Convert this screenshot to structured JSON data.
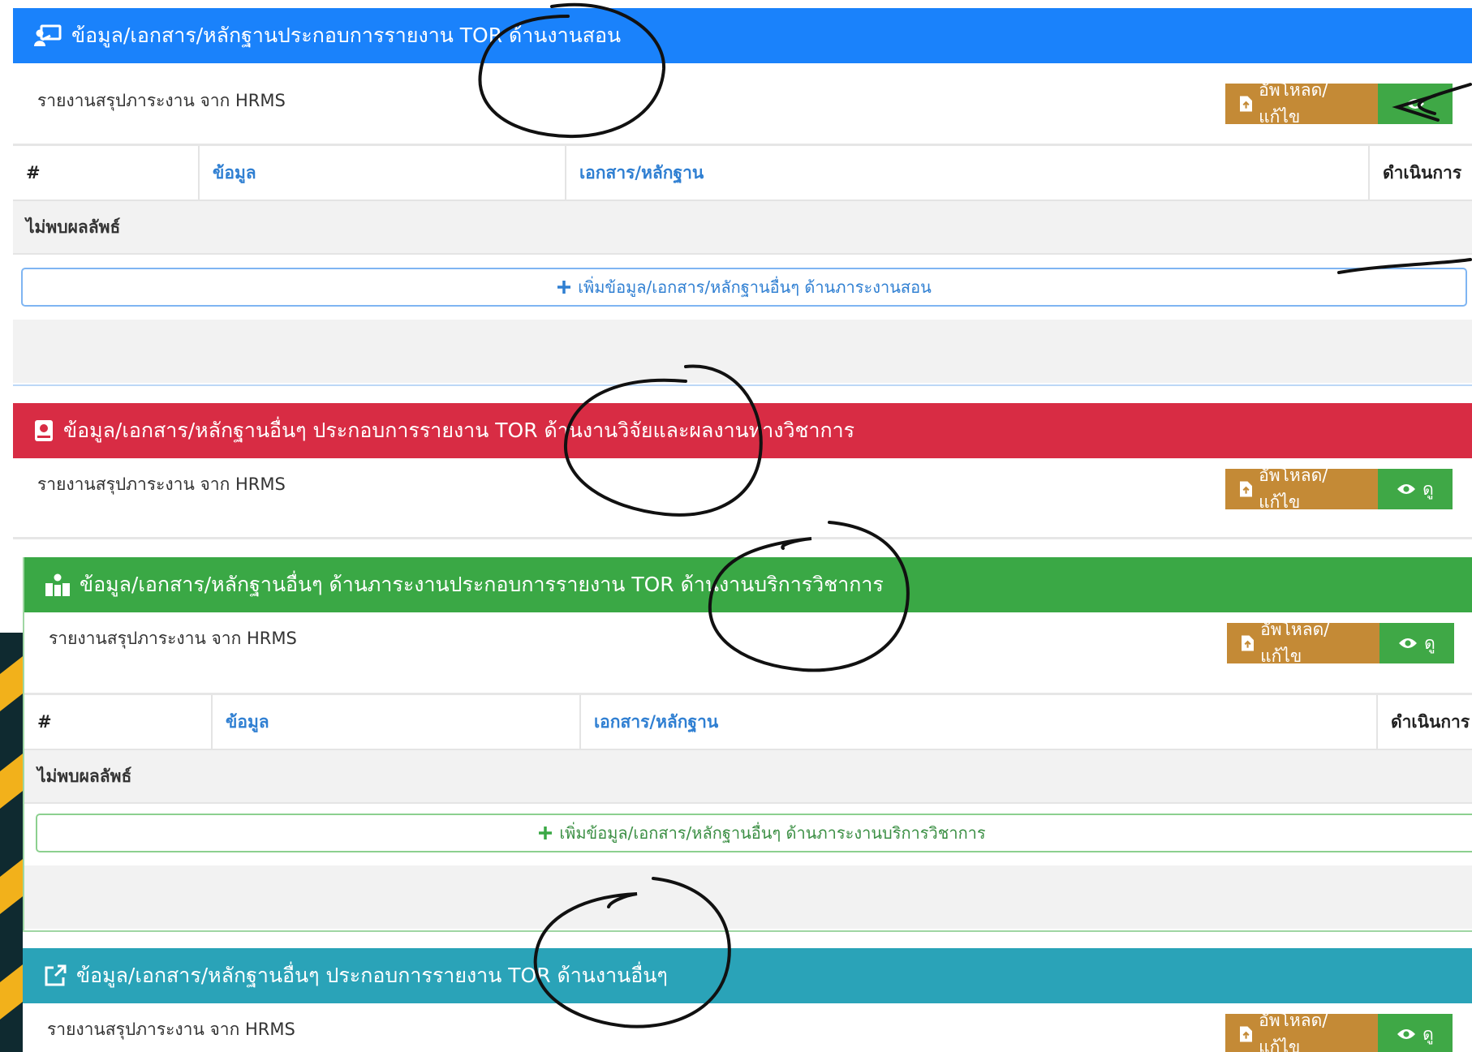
{
  "common": {
    "subtitle": "รายงานสรุปภาระงาน จาก HRMS",
    "upload_label": "อัพโหลด/แก้ไข",
    "view_label": "ดู",
    "col_index": "#",
    "col_info": "ข้อมูล",
    "col_docs": "เอกสาร/หลักฐาน",
    "col_action": "ดำเนินการ",
    "no_results": "ไม่พบผลลัพธ์"
  },
  "panels": [
    {
      "title": "ข้อมูล/เอกสาร/หลักฐานประกอบการรายงาน TOR ด้านงานสอน",
      "color": "#1a82fb",
      "add_label": "เพิ่มข้อมูล/เอกสาร/หลักฐานอื่นๆ ด้านภาระงานสอน",
      "icon": "chalkboard-teacher-icon"
    },
    {
      "title": "ข้อมูล/เอกสาร/หลักฐานอื่นๆ ประกอบการรายงาน TOR ด้านงานวิจัยและผลงานทางวิชาการ",
      "color": "#d82c44",
      "icon": "book-icon"
    },
    {
      "title": "ข้อมูล/เอกสาร/หลักฐานอื่นๆ ด้านภาระงานประกอบการรายงาน TOR ด้านงานบริการวิชาการ",
      "color": "#3aa845",
      "add_label": "เพิ่มข้อมูล/เอกสาร/หลักฐานอื่นๆ ด้านภาระงานบริการวิชาการ",
      "icon": "hands-helping-icon"
    },
    {
      "title": "ข้อมูล/เอกสาร/หลักฐานอื่นๆ ประกอบการรายงาน TOR ด้านงานอื่นๆ",
      "color": "#2aa3b8",
      "icon": "external-link-icon"
    }
  ]
}
